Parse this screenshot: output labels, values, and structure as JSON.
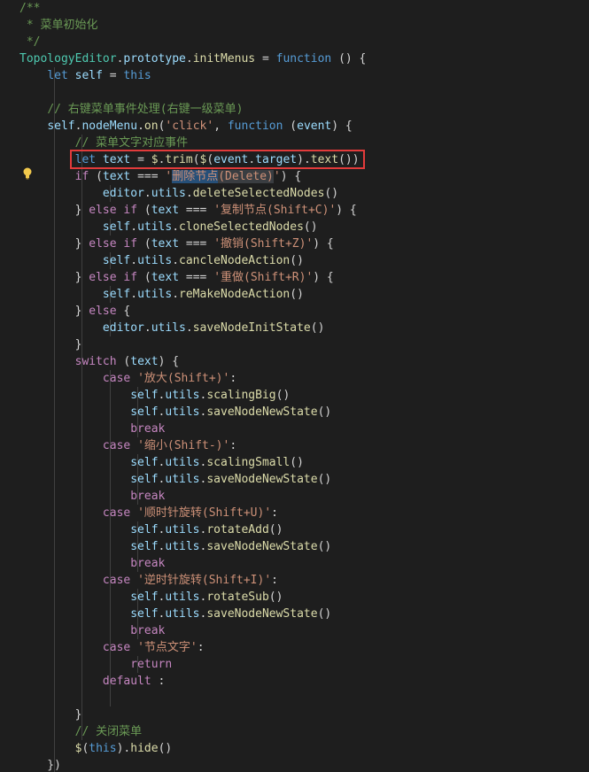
{
  "editor": {
    "lines": [
      [
        {
          "c": "t-comment",
          "t": "/**"
        }
      ],
      [
        {
          "c": "t-comment",
          "t": " * 菜单初始化"
        }
      ],
      [
        {
          "c": "t-comment",
          "t": " */"
        }
      ],
      [
        {
          "c": "t-class",
          "t": "TopologyEditor"
        },
        {
          "c": "t-punc",
          "t": "."
        },
        {
          "c": "t-var",
          "t": "prototype"
        },
        {
          "c": "t-punc",
          "t": "."
        },
        {
          "c": "t-func",
          "t": "initMenus"
        },
        {
          "c": "t-punc",
          "t": " = "
        },
        {
          "c": "t-keyword",
          "t": "function"
        },
        {
          "c": "t-punc",
          "t": " () {"
        }
      ],
      [
        {
          "c": "t-punc",
          "t": "    "
        },
        {
          "c": "t-keyword",
          "t": "let"
        },
        {
          "c": "t-punc",
          "t": " "
        },
        {
          "c": "t-var",
          "t": "self"
        },
        {
          "c": "t-punc",
          "t": " = "
        },
        {
          "c": "t-keyword",
          "t": "this"
        }
      ],
      [],
      [
        {
          "c": "t-punc",
          "t": "    "
        },
        {
          "c": "t-comment",
          "t": "// 右键菜单事件处理(右键一级菜单)"
        }
      ],
      [
        {
          "c": "t-punc",
          "t": "    "
        },
        {
          "c": "t-var",
          "t": "self"
        },
        {
          "c": "t-punc",
          "t": "."
        },
        {
          "c": "t-var",
          "t": "nodeMenu"
        },
        {
          "c": "t-punc",
          "t": "."
        },
        {
          "c": "t-func",
          "t": "on"
        },
        {
          "c": "t-punc",
          "t": "("
        },
        {
          "c": "t-string",
          "t": "'click'"
        },
        {
          "c": "t-punc",
          "t": ", "
        },
        {
          "c": "t-keyword",
          "t": "function"
        },
        {
          "c": "t-punc",
          "t": " ("
        },
        {
          "c": "t-var",
          "t": "event"
        },
        {
          "c": "t-punc",
          "t": ") {"
        }
      ],
      [
        {
          "c": "t-punc",
          "t": "        "
        },
        {
          "c": "t-comment",
          "t": "// 菜单文字对应事件"
        }
      ],
      [
        {
          "c": "t-punc",
          "t": "        "
        },
        {
          "c": "t-keyword",
          "t": "let"
        },
        {
          "c": "t-punc",
          "t": " "
        },
        {
          "c": "t-var",
          "t": "text"
        },
        {
          "c": "t-punc",
          "t": " = "
        },
        {
          "c": "t-func",
          "t": "$"
        },
        {
          "c": "t-punc",
          "t": "."
        },
        {
          "c": "t-func",
          "t": "trim"
        },
        {
          "c": "t-punc",
          "t": "("
        },
        {
          "c": "t-func",
          "t": "$"
        },
        {
          "c": "t-punc",
          "t": "("
        },
        {
          "c": "t-var",
          "t": "event"
        },
        {
          "c": "t-punc",
          "t": "."
        },
        {
          "c": "t-var",
          "t": "target"
        },
        {
          "c": "t-punc",
          "t": ")."
        },
        {
          "c": "t-func",
          "t": "text"
        },
        {
          "c": "t-punc",
          "t": "())"
        }
      ],
      [
        {
          "c": "t-punc",
          "t": "        "
        },
        {
          "c": "t-control",
          "t": "if"
        },
        {
          "c": "t-punc",
          "t": " ("
        },
        {
          "c": "t-var",
          "t": "text"
        },
        {
          "c": "t-punc",
          "t": " === "
        },
        {
          "c": "t-string",
          "t": "'"
        },
        {
          "c": "t-string t-selected",
          "t": "删除节点"
        },
        {
          "c": "t-string t-word-highlight",
          "t": "(Delete)"
        },
        {
          "c": "t-string",
          "t": "'"
        },
        {
          "c": "t-punc",
          "t": ") {"
        }
      ],
      [
        {
          "c": "t-punc",
          "t": "            "
        },
        {
          "c": "t-var",
          "t": "editor"
        },
        {
          "c": "t-punc",
          "t": "."
        },
        {
          "c": "t-var",
          "t": "utils"
        },
        {
          "c": "t-punc",
          "t": "."
        },
        {
          "c": "t-func",
          "t": "deleteSelectedNodes"
        },
        {
          "c": "t-punc",
          "t": "()"
        }
      ],
      [
        {
          "c": "t-punc",
          "t": "        } "
        },
        {
          "c": "t-control",
          "t": "else"
        },
        {
          "c": "t-punc",
          "t": " "
        },
        {
          "c": "t-control",
          "t": "if"
        },
        {
          "c": "t-punc",
          "t": " ("
        },
        {
          "c": "t-var",
          "t": "text"
        },
        {
          "c": "t-punc",
          "t": " === "
        },
        {
          "c": "t-string",
          "t": "'复制节点(Shift+C)'"
        },
        {
          "c": "t-punc",
          "t": ") {"
        }
      ],
      [
        {
          "c": "t-punc",
          "t": "            "
        },
        {
          "c": "t-var",
          "t": "self"
        },
        {
          "c": "t-punc",
          "t": "."
        },
        {
          "c": "t-var",
          "t": "utils"
        },
        {
          "c": "t-punc",
          "t": "."
        },
        {
          "c": "t-func",
          "t": "cloneSelectedNodes"
        },
        {
          "c": "t-punc",
          "t": "()"
        }
      ],
      [
        {
          "c": "t-punc",
          "t": "        } "
        },
        {
          "c": "t-control",
          "t": "else"
        },
        {
          "c": "t-punc",
          "t": " "
        },
        {
          "c": "t-control",
          "t": "if"
        },
        {
          "c": "t-punc",
          "t": " ("
        },
        {
          "c": "t-var",
          "t": "text"
        },
        {
          "c": "t-punc",
          "t": " === "
        },
        {
          "c": "t-string",
          "t": "'撤销(Shift+Z)'"
        },
        {
          "c": "t-punc",
          "t": ") {"
        }
      ],
      [
        {
          "c": "t-punc",
          "t": "            "
        },
        {
          "c": "t-var",
          "t": "self"
        },
        {
          "c": "t-punc",
          "t": "."
        },
        {
          "c": "t-var",
          "t": "utils"
        },
        {
          "c": "t-punc",
          "t": "."
        },
        {
          "c": "t-func",
          "t": "cancleNodeAction"
        },
        {
          "c": "t-punc",
          "t": "()"
        }
      ],
      [
        {
          "c": "t-punc",
          "t": "        } "
        },
        {
          "c": "t-control",
          "t": "else"
        },
        {
          "c": "t-punc",
          "t": " "
        },
        {
          "c": "t-control",
          "t": "if"
        },
        {
          "c": "t-punc",
          "t": " ("
        },
        {
          "c": "t-var",
          "t": "text"
        },
        {
          "c": "t-punc",
          "t": " === "
        },
        {
          "c": "t-string",
          "t": "'重做(Shift+R)'"
        },
        {
          "c": "t-punc",
          "t": ") {"
        }
      ],
      [
        {
          "c": "t-punc",
          "t": "            "
        },
        {
          "c": "t-var",
          "t": "self"
        },
        {
          "c": "t-punc",
          "t": "."
        },
        {
          "c": "t-var",
          "t": "utils"
        },
        {
          "c": "t-punc",
          "t": "."
        },
        {
          "c": "t-func",
          "t": "reMakeNodeAction"
        },
        {
          "c": "t-punc",
          "t": "()"
        }
      ],
      [
        {
          "c": "t-punc",
          "t": "        } "
        },
        {
          "c": "t-control",
          "t": "else"
        },
        {
          "c": "t-punc",
          "t": " {"
        }
      ],
      [
        {
          "c": "t-punc",
          "t": "            "
        },
        {
          "c": "t-var",
          "t": "editor"
        },
        {
          "c": "t-punc",
          "t": "."
        },
        {
          "c": "t-var",
          "t": "utils"
        },
        {
          "c": "t-punc",
          "t": "."
        },
        {
          "c": "t-func",
          "t": "saveNodeInitState"
        },
        {
          "c": "t-punc",
          "t": "()"
        }
      ],
      [
        {
          "c": "t-punc",
          "t": "        }"
        }
      ],
      [
        {
          "c": "t-punc",
          "t": "        "
        },
        {
          "c": "t-control",
          "t": "switch"
        },
        {
          "c": "t-punc",
          "t": " ("
        },
        {
          "c": "t-var",
          "t": "text"
        },
        {
          "c": "t-punc",
          "t": ") {"
        }
      ],
      [
        {
          "c": "t-punc",
          "t": "            "
        },
        {
          "c": "t-control",
          "t": "case"
        },
        {
          "c": "t-punc",
          "t": " "
        },
        {
          "c": "t-string",
          "t": "'放大(Shift+)'"
        },
        {
          "c": "t-punc",
          "t": ":"
        }
      ],
      [
        {
          "c": "t-punc",
          "t": "                "
        },
        {
          "c": "t-var",
          "t": "self"
        },
        {
          "c": "t-punc",
          "t": "."
        },
        {
          "c": "t-var",
          "t": "utils"
        },
        {
          "c": "t-punc",
          "t": "."
        },
        {
          "c": "t-func",
          "t": "scalingBig"
        },
        {
          "c": "t-punc",
          "t": "()"
        }
      ],
      [
        {
          "c": "t-punc",
          "t": "                "
        },
        {
          "c": "t-var",
          "t": "self"
        },
        {
          "c": "t-punc",
          "t": "."
        },
        {
          "c": "t-var",
          "t": "utils"
        },
        {
          "c": "t-punc",
          "t": "."
        },
        {
          "c": "t-func",
          "t": "saveNodeNewState"
        },
        {
          "c": "t-punc",
          "t": "()"
        }
      ],
      [
        {
          "c": "t-punc",
          "t": "                "
        },
        {
          "c": "t-control",
          "t": "break"
        }
      ],
      [
        {
          "c": "t-punc",
          "t": "            "
        },
        {
          "c": "t-control",
          "t": "case"
        },
        {
          "c": "t-punc",
          "t": " "
        },
        {
          "c": "t-string",
          "t": "'缩小(Shift-)'"
        },
        {
          "c": "t-punc",
          "t": ":"
        }
      ],
      [
        {
          "c": "t-punc",
          "t": "                "
        },
        {
          "c": "t-var",
          "t": "self"
        },
        {
          "c": "t-punc",
          "t": "."
        },
        {
          "c": "t-var",
          "t": "utils"
        },
        {
          "c": "t-punc",
          "t": "."
        },
        {
          "c": "t-func",
          "t": "scalingSmall"
        },
        {
          "c": "t-punc",
          "t": "()"
        }
      ],
      [
        {
          "c": "t-punc",
          "t": "                "
        },
        {
          "c": "t-var",
          "t": "self"
        },
        {
          "c": "t-punc",
          "t": "."
        },
        {
          "c": "t-var",
          "t": "utils"
        },
        {
          "c": "t-punc",
          "t": "."
        },
        {
          "c": "t-func",
          "t": "saveNodeNewState"
        },
        {
          "c": "t-punc",
          "t": "()"
        }
      ],
      [
        {
          "c": "t-punc",
          "t": "                "
        },
        {
          "c": "t-control",
          "t": "break"
        }
      ],
      [
        {
          "c": "t-punc",
          "t": "            "
        },
        {
          "c": "t-control",
          "t": "case"
        },
        {
          "c": "t-punc",
          "t": " "
        },
        {
          "c": "t-string",
          "t": "'顺时针旋转(Shift+U)'"
        },
        {
          "c": "t-punc",
          "t": ":"
        }
      ],
      [
        {
          "c": "t-punc",
          "t": "                "
        },
        {
          "c": "t-var",
          "t": "self"
        },
        {
          "c": "t-punc",
          "t": "."
        },
        {
          "c": "t-var",
          "t": "utils"
        },
        {
          "c": "t-punc",
          "t": "."
        },
        {
          "c": "t-func",
          "t": "rotateAdd"
        },
        {
          "c": "t-punc",
          "t": "()"
        }
      ],
      [
        {
          "c": "t-punc",
          "t": "                "
        },
        {
          "c": "t-var",
          "t": "self"
        },
        {
          "c": "t-punc",
          "t": "."
        },
        {
          "c": "t-var",
          "t": "utils"
        },
        {
          "c": "t-punc",
          "t": "."
        },
        {
          "c": "t-func",
          "t": "saveNodeNewState"
        },
        {
          "c": "t-punc",
          "t": "()"
        }
      ],
      [
        {
          "c": "t-punc",
          "t": "                "
        },
        {
          "c": "t-control",
          "t": "break"
        }
      ],
      [
        {
          "c": "t-punc",
          "t": "            "
        },
        {
          "c": "t-control",
          "t": "case"
        },
        {
          "c": "t-punc",
          "t": " "
        },
        {
          "c": "t-string",
          "t": "'逆时针旋转(Shift+I)'"
        },
        {
          "c": "t-punc",
          "t": ":"
        }
      ],
      [
        {
          "c": "t-punc",
          "t": "                "
        },
        {
          "c": "t-var",
          "t": "self"
        },
        {
          "c": "t-punc",
          "t": "."
        },
        {
          "c": "t-var",
          "t": "utils"
        },
        {
          "c": "t-punc",
          "t": "."
        },
        {
          "c": "t-func",
          "t": "rotateSub"
        },
        {
          "c": "t-punc",
          "t": "()"
        }
      ],
      [
        {
          "c": "t-punc",
          "t": "                "
        },
        {
          "c": "t-var",
          "t": "self"
        },
        {
          "c": "t-punc",
          "t": "."
        },
        {
          "c": "t-var",
          "t": "utils"
        },
        {
          "c": "t-punc",
          "t": "."
        },
        {
          "c": "t-func",
          "t": "saveNodeNewState"
        },
        {
          "c": "t-punc",
          "t": "()"
        }
      ],
      [
        {
          "c": "t-punc",
          "t": "                "
        },
        {
          "c": "t-control",
          "t": "break"
        }
      ],
      [
        {
          "c": "t-punc",
          "t": "            "
        },
        {
          "c": "t-control",
          "t": "case"
        },
        {
          "c": "t-punc",
          "t": " "
        },
        {
          "c": "t-string",
          "t": "'节点文字'"
        },
        {
          "c": "t-punc",
          "t": ":"
        }
      ],
      [
        {
          "c": "t-punc",
          "t": "                "
        },
        {
          "c": "t-control",
          "t": "return"
        }
      ],
      [
        {
          "c": "t-punc",
          "t": "            "
        },
        {
          "c": "t-control",
          "t": "default"
        },
        {
          "c": "t-punc",
          "t": " :"
        }
      ],
      [],
      [
        {
          "c": "t-punc",
          "t": "        }"
        }
      ],
      [
        {
          "c": "t-punc",
          "t": "        "
        },
        {
          "c": "t-comment",
          "t": "// 关闭菜单"
        }
      ],
      [
        {
          "c": "t-punc",
          "t": "        "
        },
        {
          "c": "t-func",
          "t": "$"
        },
        {
          "c": "t-punc",
          "t": "("
        },
        {
          "c": "t-keyword",
          "t": "this"
        },
        {
          "c": "t-punc",
          "t": ")."
        },
        {
          "c": "t-func",
          "t": "hide"
        },
        {
          "c": "t-punc",
          "t": "()"
        }
      ],
      [
        {
          "c": "t-punc",
          "t": "    })"
        }
      ]
    ],
    "highlighted_line_index": 9,
    "lightbulb_line_index": 10,
    "colors": {
      "background": "#1e1e1e",
      "highlight_border": "#e23b3b",
      "lightbulb": "#f2c94c"
    },
    "icons": {
      "lightbulb": "lightbulb-icon"
    }
  }
}
